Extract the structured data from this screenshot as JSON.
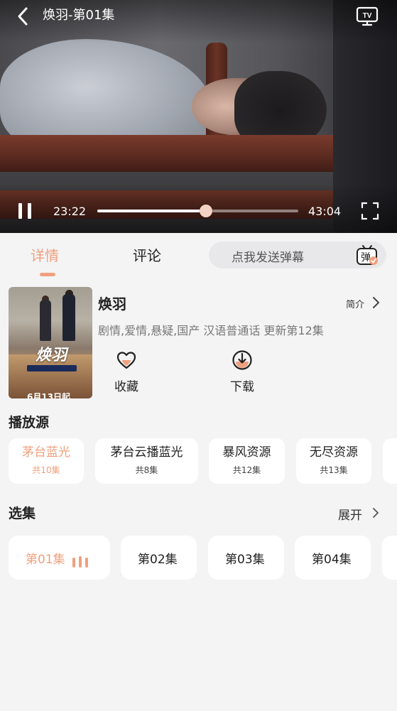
{
  "player": {
    "title": "焕羽-第01集",
    "current_time": "23:22",
    "total_time": "43:04",
    "progress_fraction": 0.541,
    "tv_icon_text": "TV"
  },
  "tabs": [
    {
      "label": "详情",
      "active": true
    },
    {
      "label": "评论",
      "active": false
    }
  ],
  "danmu": {
    "placeholder": "点我发送弹幕",
    "icon_text": "弹"
  },
  "show": {
    "title": "焕羽",
    "intro_label": "简介",
    "meta": "剧情,爱情,悬疑,国产 汉语普通话 更新第12集",
    "poster_date": "6月13日起"
  },
  "actions": [
    {
      "label": "收藏",
      "icon": "heart-icon"
    },
    {
      "label": "下载",
      "icon": "download-icon"
    }
  ],
  "sources": {
    "title": "播放源",
    "items": [
      {
        "name": "茅台蓝光",
        "count": "共10集",
        "active": true
      },
      {
        "name": "茅台云播蓝光",
        "count": "共8集",
        "active": false
      },
      {
        "name": "暴风资源",
        "count": "共12集",
        "active": false
      },
      {
        "name": "无尽资源",
        "count": "共13集",
        "active": false
      }
    ]
  },
  "episodes": {
    "title": "选集",
    "expand_label": "展开",
    "items": [
      {
        "label": "第01集",
        "active": true
      },
      {
        "label": "第02集",
        "active": false
      },
      {
        "label": "第03集",
        "active": false
      },
      {
        "label": "第04集",
        "active": false
      }
    ]
  },
  "colors": {
    "accent": "#f0a07e",
    "background": "#f4f4f5",
    "card": "#ffffff"
  }
}
